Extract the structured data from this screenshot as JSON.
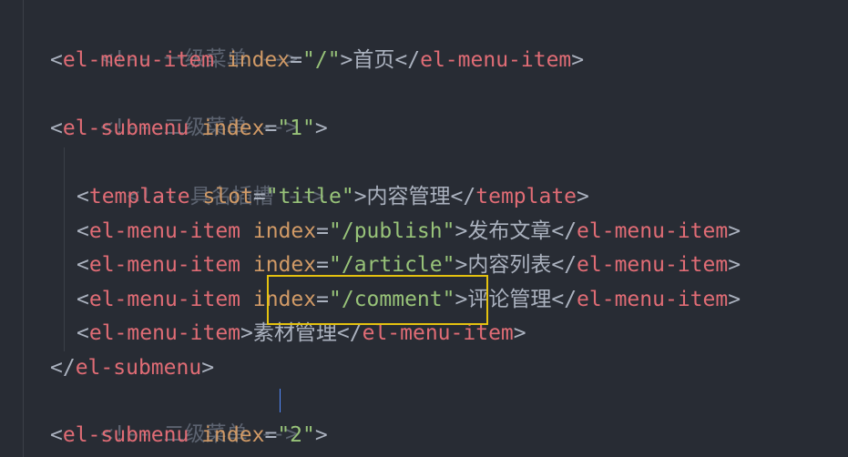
{
  "editor": {
    "lines": [
      {
        "comment": "<!-- 一级菜单 -->"
      },
      {
        "open": "<",
        "tag": "el-menu-item",
        "attr": "index",
        "eq": "=",
        "value": "\"/\"",
        "close": ">",
        "text": "首页",
        "end_open": "</",
        "end_tag": "el-menu-item",
        "end_close": ">"
      },
      {
        "comment": "<!-- 二级菜单 -->"
      },
      {
        "open": "<",
        "tag": "el-submenu",
        "attr": "index",
        "eq": "=",
        "value": "\"1\"",
        "close": ">"
      },
      {
        "comment": "<!-- 具名插槽 -->"
      },
      {
        "open": "<",
        "tag": "template",
        "attr": "slot",
        "eq": "=",
        "value": "\"title\"",
        "close": ">",
        "text": "内容管理",
        "end_open": "</",
        "end_tag": "template",
        "end_close": ">"
      },
      {
        "open": "<",
        "tag": "el-menu-item",
        "attr": "index",
        "eq": "=",
        "value": "\"/publish\"",
        "close": ">",
        "text": "发布文章",
        "end_open": "</",
        "end_tag": "el-menu-item",
        "end_close": ">"
      },
      {
        "open": "<",
        "tag": "el-menu-item",
        "attr": "index",
        "eq": "=",
        "value": "\"/article\"",
        "close": ">",
        "text": "内容列表",
        "end_open": "</",
        "end_tag": "el-menu-item",
        "end_close": ">"
      },
      {
        "open": "<",
        "tag": "el-menu-item",
        "attr": "index",
        "eq": "=",
        "value": "\"/comment\"",
        "close": ">",
        "text": "评论管理",
        "end_open": "</",
        "end_tag": "el-menu-item",
        "end_close": ">"
      },
      {
        "open": "<",
        "tag": "el-menu-item",
        "close": ">",
        "text": "素材管理",
        "end_open": "</",
        "end_tag": "el-menu-item",
        "end_close": ">"
      },
      {
        "open": "</",
        "tag": "el-submenu",
        "close": ">"
      },
      {
        "comment": "<!-- 二级菜单 -->"
      },
      {
        "open": "<",
        "tag": "el-submenu",
        "attr": "index",
        "eq": "=",
        "value": "\"2\"",
        "close": ">"
      }
    ]
  },
  "colors": {
    "background": "#282c34",
    "tag": "#e06c75",
    "attribute": "#d19a66",
    "string": "#98c379",
    "comment": "#5c6370",
    "highlight": "#e5c20f"
  }
}
